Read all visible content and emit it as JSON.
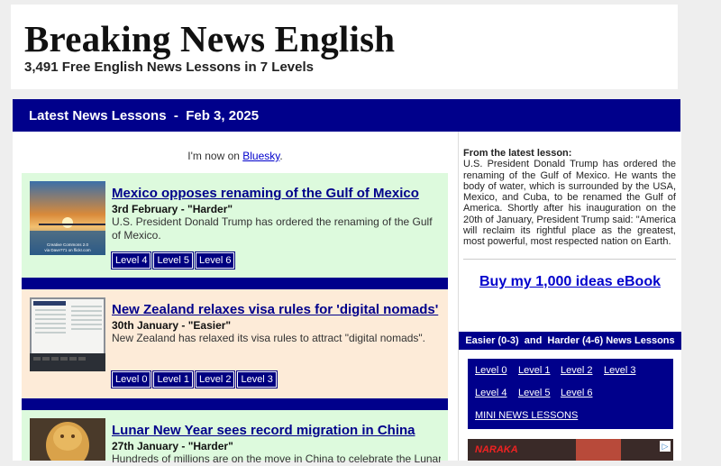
{
  "header": {
    "title": "Breaking News English",
    "subtitle": "3,491 Free English News Lessons in 7 Levels"
  },
  "banner": {
    "text": "Latest News Lessons  -  Feb 3, 2025"
  },
  "bluesky": {
    "prefix": "I'm now on ",
    "link": "Bluesky",
    "suffix": "."
  },
  "lessons": [
    {
      "headline": "Mexico opposes renaming of the Gulf of Mexico",
      "date": "3rd February - \"Harder\"",
      "summary": "U.S. President Donald Trump has ordered the renaming of the Gulf of Mexico.",
      "thumb_caption": "Creative Commons 2.0 via Dave?71 on flickr.com",
      "levels": [
        "Level 4",
        "Level 5",
        "Level 6"
      ]
    },
    {
      "headline": "New Zealand relaxes visa rules for 'digital nomads'",
      "date": "30th January - \"Easier\"",
      "summary": "New Zealand has relaxed its visa rules to attract \"digital nomads\".",
      "thumb_caption": "Breaking News English",
      "levels": [
        "Level 0",
        "Level 1",
        "Level 2",
        "Level 3"
      ]
    },
    {
      "headline": "Lunar New Year sees record migration in China",
      "date": "27th January - \"Harder\"",
      "summary": "Hundreds of millions are on the move in China to celebrate the Lunar",
      "levels": []
    }
  ],
  "sidebar": {
    "from_label": "From the latest lesson",
    "from_text": "U.S. President Donald Trump has ordered the renaming of the Gulf of Mexico. He wants the body of water, which is surrounded by the USA, Mexico, and Cuba, to be renamed the Gulf of America. Shortly after his inauguration on the 20th of January, President Trump said: \"America will reclaim its rightful place as the greatest, most powerful, most respected nation on Earth.",
    "ebook": "Buy my 1,000 ideas eBook",
    "levels_title": "Easier (0-3)  and  Harder (4-6) News Lessons",
    "level_links": [
      "Level 0",
      "Level 1",
      "Level 2",
      "Level 3",
      "Level 4",
      "Level 5",
      "Level 6"
    ],
    "mini": "MINI NEWS LESSONS",
    "ad_brand": "NARAKA"
  },
  "colors": {
    "navy": "#00008b",
    "link": "#0000cc",
    "green_bg": "#ddfadd",
    "peach_bg": "#fdebd8"
  }
}
